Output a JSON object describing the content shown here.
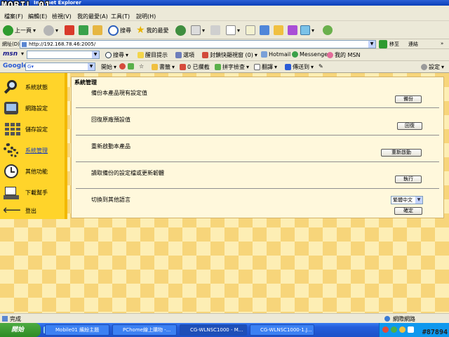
{
  "window": {
    "title": "Internet Explorer",
    "watermark": "MOBIL 01"
  },
  "menu": {
    "items": [
      "檔案(F)",
      "編輯(E)",
      "檢視(V)",
      "我的最愛(A)",
      "工具(T)",
      "說明(H)"
    ]
  },
  "toolbar": {
    "back": "上一頁",
    "search": "搜尋",
    "favorites": "我的最愛"
  },
  "address": {
    "label": "網址(D)",
    "url": "http://192.168.78.46:2005/",
    "go": "移至",
    "links": "連結"
  },
  "msn": {
    "logo": "msn",
    "search": "搜尋",
    "highlight": "醒目提示",
    "options": "選項",
    "popup": "封鎖快顯視窗 (0)",
    "hotmail": "Hotmail",
    "messenger": "Messenger",
    "mymsn": "我的 MSN"
  },
  "google": {
    "logo": "Google",
    "input_prefix": "G",
    "start": "開始",
    "bookmarks": "書籤",
    "blocked": "0 已攔截",
    "spell": "拼字檢查",
    "translate": "翻譯",
    "sendto": "傳送到",
    "settings": "設定"
  },
  "sidebar": {
    "items": [
      {
        "label": "系統狀態",
        "icon": "magnifier-icon"
      },
      {
        "label": "網路設定",
        "icon": "network-icon"
      },
      {
        "label": "儲存設定",
        "icon": "storage-grid-icon"
      },
      {
        "label": "系統管理",
        "icon": "gears-icon",
        "selected": true
      },
      {
        "label": "其他功能",
        "icon": "clock-icon"
      },
      {
        "label": "下載幫手",
        "icon": "download-icon"
      },
      {
        "label": "登出",
        "icon": "logout-arrow-icon"
      }
    ]
  },
  "panel": {
    "title": "系統管理",
    "rows": [
      {
        "text": "備份本產品現有設定值",
        "button": "備份"
      },
      {
        "text": "回復原廠預設值",
        "button": "回復"
      },
      {
        "text": "重新啟動本產品",
        "button": "重新啟動"
      },
      {
        "text": "讀取備份的設定檔或更新韌體",
        "button": "執行"
      },
      {
        "text": "切換到其他語言",
        "button": "確定",
        "select": "繁體中文"
      }
    ]
  },
  "status": {
    "left": "完成",
    "right": "網際網路"
  },
  "taskbar": {
    "start": "開始",
    "tasks": [
      "Mobile01 繽紛主題",
      "PChome線上購物 -...",
      "CG-WLNSC1000 - M...",
      "CG-WLNSC1000-1.J..."
    ],
    "clock": "#87894"
  }
}
